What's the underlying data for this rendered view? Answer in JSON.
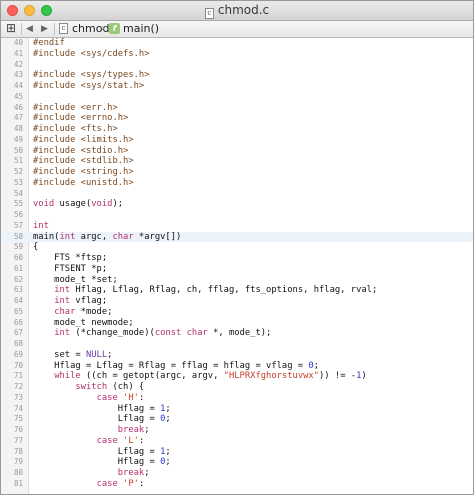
{
  "window": {
    "title": "chmod.c",
    "title_icon": "c-source-file-icon"
  },
  "jumpbar": {
    "grid_icon": "related-files-grid-icon",
    "back_label": "◀",
    "forward_label": "▶",
    "file_icon_letter": "c",
    "file": "chmod.c",
    "chevron": "›",
    "function_icon_letter": "f",
    "function": "main()"
  },
  "colors": {
    "keyword": "#b5306e",
    "preprocessor": "#7b4a22",
    "string": "#c4402a",
    "number": "#2b32d6",
    "type": "#6c3ba8",
    "current_line": "#edf3fa"
  },
  "editor": {
    "current_line": 58,
    "lines": [
      {
        "n": "40",
        "tokens": [
          {
            "t": "pp",
            "s": "#endif"
          }
        ]
      },
      {
        "n": "41",
        "tokens": [
          {
            "t": "pp",
            "s": "#include <sys/cdefs.h>"
          }
        ]
      },
      {
        "n": "42",
        "tokens": []
      },
      {
        "n": "43",
        "tokens": [
          {
            "t": "pp",
            "s": "#include <sys/types.h>"
          }
        ]
      },
      {
        "n": "44",
        "tokens": [
          {
            "t": "pp",
            "s": "#include <sys/stat.h>"
          }
        ]
      },
      {
        "n": "45",
        "tokens": []
      },
      {
        "n": "46",
        "tokens": [
          {
            "t": "pp",
            "s": "#include <err.h>"
          }
        ]
      },
      {
        "n": "47",
        "tokens": [
          {
            "t": "pp",
            "s": "#include <errno.h>"
          }
        ]
      },
      {
        "n": "48",
        "tokens": [
          {
            "t": "pp",
            "s": "#include <fts.h>"
          }
        ]
      },
      {
        "n": "49",
        "tokens": [
          {
            "t": "pp",
            "s": "#include <limits.h>"
          }
        ]
      },
      {
        "n": "50",
        "tokens": [
          {
            "t": "pp",
            "s": "#include <stdio.h>"
          }
        ]
      },
      {
        "n": "51",
        "tokens": [
          {
            "t": "pp",
            "s": "#include <stdlib.h>"
          }
        ]
      },
      {
        "n": "52",
        "tokens": [
          {
            "t": "pp",
            "s": "#include <string.h>"
          }
        ]
      },
      {
        "n": "53",
        "tokens": [
          {
            "t": "pp",
            "s": "#include <unistd.h>"
          }
        ]
      },
      {
        "n": "54",
        "tokens": []
      },
      {
        "n": "55",
        "tokens": [
          {
            "t": "kw",
            "s": "void"
          },
          {
            "t": "pl",
            "s": " usage("
          },
          {
            "t": "kw",
            "s": "void"
          },
          {
            "t": "pl",
            "s": ");"
          }
        ]
      },
      {
        "n": "56",
        "tokens": []
      },
      {
        "n": "57",
        "tokens": [
          {
            "t": "kw",
            "s": "int"
          }
        ]
      },
      {
        "n": "58",
        "tokens": [
          {
            "t": "pl",
            "s": "main("
          },
          {
            "t": "kw",
            "s": "int"
          },
          {
            "t": "pl",
            "s": " argc, "
          },
          {
            "t": "kw",
            "s": "char"
          },
          {
            "t": "pl",
            "s": " *argv[])"
          }
        ]
      },
      {
        "n": "59",
        "tokens": [
          {
            "t": "pl",
            "s": "{"
          }
        ]
      },
      {
        "n": "60",
        "tokens": [
          {
            "t": "pl",
            "s": "    FTS *ftsp;"
          }
        ]
      },
      {
        "n": "61",
        "tokens": [
          {
            "t": "pl",
            "s": "    FTSENT *p;"
          }
        ]
      },
      {
        "n": "62",
        "tokens": [
          {
            "t": "pl",
            "s": "    mode_t *set;"
          }
        ]
      },
      {
        "n": "63",
        "tokens": [
          {
            "t": "pl",
            "s": "    "
          },
          {
            "t": "kw",
            "s": "int"
          },
          {
            "t": "pl",
            "s": " Hflag, Lflag, Rflag, ch, fflag, fts_options, hflag, rval;"
          }
        ]
      },
      {
        "n": "64",
        "tokens": [
          {
            "t": "pl",
            "s": "    "
          },
          {
            "t": "kw",
            "s": "int"
          },
          {
            "t": "pl",
            "s": " vflag;"
          }
        ]
      },
      {
        "n": "65",
        "tokens": [
          {
            "t": "pl",
            "s": "    "
          },
          {
            "t": "kw",
            "s": "char"
          },
          {
            "t": "pl",
            "s": " *mode;"
          }
        ]
      },
      {
        "n": "66",
        "tokens": [
          {
            "t": "pl",
            "s": "    mode_t newmode;"
          }
        ]
      },
      {
        "n": "67",
        "tokens": [
          {
            "t": "pl",
            "s": "    "
          },
          {
            "t": "kw",
            "s": "int"
          },
          {
            "t": "pl",
            "s": " (*change_mode)("
          },
          {
            "t": "kw",
            "s": "const char"
          },
          {
            "t": "pl",
            "s": " *, mode_t);"
          }
        ]
      },
      {
        "n": "68",
        "tokens": []
      },
      {
        "n": "69",
        "tokens": [
          {
            "t": "pl",
            "s": "    set = "
          },
          {
            "t": "type",
            "s": "NULL"
          },
          {
            "t": "pl",
            "s": ";"
          }
        ]
      },
      {
        "n": "70",
        "tokens": [
          {
            "t": "pl",
            "s": "    Hflag = Lflag = Rflag = fflag = hflag = vflag = "
          },
          {
            "t": "num",
            "s": "0"
          },
          {
            "t": "pl",
            "s": ";"
          }
        ]
      },
      {
        "n": "71",
        "tokens": [
          {
            "t": "pl",
            "s": "    "
          },
          {
            "t": "kw",
            "s": "while"
          },
          {
            "t": "pl",
            "s": " ((ch = getopt(argc, argv, "
          },
          {
            "t": "str",
            "s": "\"HLPRXfghorstuvwx\""
          },
          {
            "t": "pl",
            "s": ")) != -"
          },
          {
            "t": "num",
            "s": "1"
          },
          {
            "t": "pl",
            "s": ")"
          }
        ]
      },
      {
        "n": "72",
        "tokens": [
          {
            "t": "pl",
            "s": "        "
          },
          {
            "t": "kw",
            "s": "switch"
          },
          {
            "t": "pl",
            "s": " (ch) {"
          }
        ]
      },
      {
        "n": "73",
        "tokens": [
          {
            "t": "pl",
            "s": "            "
          },
          {
            "t": "kw",
            "s": "case"
          },
          {
            "t": "pl",
            "s": " "
          },
          {
            "t": "str",
            "s": "'H'"
          },
          {
            "t": "pl",
            "s": ":"
          }
        ]
      },
      {
        "n": "74",
        "tokens": [
          {
            "t": "pl",
            "s": "                Hflag = "
          },
          {
            "t": "num",
            "s": "1"
          },
          {
            "t": "pl",
            "s": ";"
          }
        ]
      },
      {
        "n": "75",
        "tokens": [
          {
            "t": "pl",
            "s": "                Lflag = "
          },
          {
            "t": "num",
            "s": "0"
          },
          {
            "t": "pl",
            "s": ";"
          }
        ]
      },
      {
        "n": "76",
        "tokens": [
          {
            "t": "pl",
            "s": "                "
          },
          {
            "t": "kw",
            "s": "break"
          },
          {
            "t": "pl",
            "s": ";"
          }
        ]
      },
      {
        "n": "77",
        "tokens": [
          {
            "t": "pl",
            "s": "            "
          },
          {
            "t": "kw",
            "s": "case"
          },
          {
            "t": "pl",
            "s": " "
          },
          {
            "t": "str",
            "s": "'L'"
          },
          {
            "t": "pl",
            "s": ":"
          }
        ]
      },
      {
        "n": "78",
        "tokens": [
          {
            "t": "pl",
            "s": "                Lflag = "
          },
          {
            "t": "num",
            "s": "1"
          },
          {
            "t": "pl",
            "s": ";"
          }
        ]
      },
      {
        "n": "79",
        "tokens": [
          {
            "t": "pl",
            "s": "                Hflag = "
          },
          {
            "t": "num",
            "s": "0"
          },
          {
            "t": "pl",
            "s": ";"
          }
        ]
      },
      {
        "n": "80",
        "tokens": [
          {
            "t": "pl",
            "s": "                "
          },
          {
            "t": "kw",
            "s": "break"
          },
          {
            "t": "pl",
            "s": ";"
          }
        ]
      },
      {
        "n": "81",
        "tokens": [
          {
            "t": "pl",
            "s": "            "
          },
          {
            "t": "kw",
            "s": "case"
          },
          {
            "t": "pl",
            "s": " "
          },
          {
            "t": "str",
            "s": "'P'"
          },
          {
            "t": "pl",
            "s": ":"
          }
        ]
      }
    ]
  }
}
